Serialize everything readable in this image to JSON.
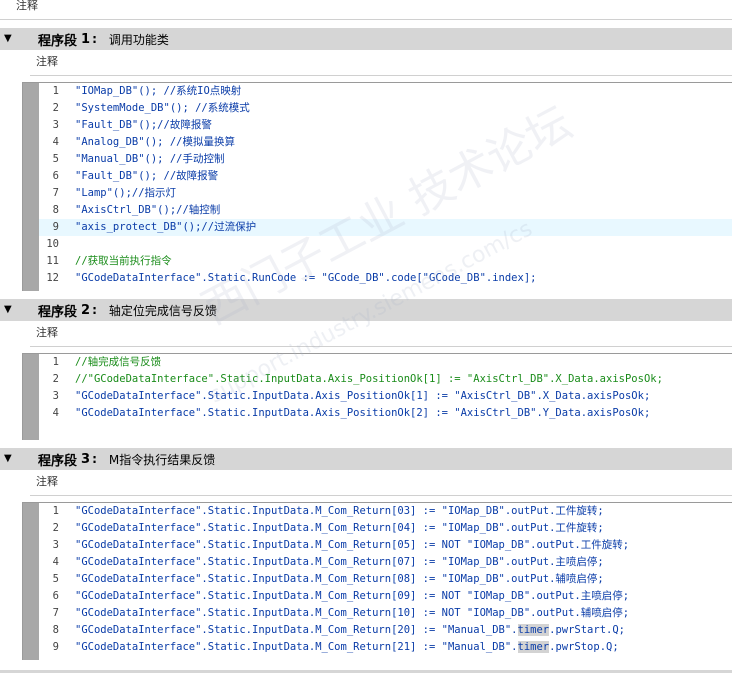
{
  "top": {
    "comment_label": "注释"
  },
  "segments": [
    {
      "label": "程序段",
      "number": "1",
      "title": "调用功能类",
      "comment_label": "注释",
      "lines": [
        {
          "n": "1",
          "code": "\"IOMap_DB\"(); //系统IO点映射"
        },
        {
          "n": "2",
          "code": "\"SystemMode_DB\"(); //系统模式"
        },
        {
          "n": "3",
          "code": "\"Fault_DB\"();//故障报警"
        },
        {
          "n": "4",
          "code": "\"Analog_DB\"(); //模拟量换算"
        },
        {
          "n": "5",
          "code": "\"Manual_DB\"(); //手动控制"
        },
        {
          "n": "6",
          "code": "\"Fault_DB\"(); //故障报警"
        },
        {
          "n": "7",
          "code": "\"Lamp\"();//指示灯"
        },
        {
          "n": "8",
          "code": "\"AxisCtrl_DB\"();//轴控制"
        },
        {
          "n": "9",
          "code": "\"axis_protect_DB\"();//过流保护"
        },
        {
          "n": "10",
          "code": ""
        },
        {
          "n": "11",
          "code": "//获取当前执行指令"
        },
        {
          "n": "12",
          "code": "\"GCodeDataInterface\".Static.RunCode := \"GCode_DB\".code[\"GCode_DB\".index];"
        }
      ]
    },
    {
      "label": "程序段",
      "number": "2",
      "title": "轴定位完成信号反馈",
      "comment_label": "注释",
      "lines": [
        {
          "n": "1",
          "code": "//轴完成信号反馈"
        },
        {
          "n": "2",
          "code": "//\"GCodeDataInterface\".Static.InputData.Axis_PositionOk[1] := \"AxisCtrl_DB\".X_Data.axisPosOk;"
        },
        {
          "n": "3",
          "code": "\"GCodeDataInterface\".Static.InputData.Axis_PositionOk[1] := \"AxisCtrl_DB\".X_Data.axisPosOk;"
        },
        {
          "n": "4",
          "code": "\"GCodeDataInterface\".Static.InputData.Axis_PositionOk[2] := \"AxisCtrl_DB\".Y_Data.axisPosOk;"
        }
      ]
    },
    {
      "label": "程序段",
      "number": "3",
      "title": "M指令执行结果反馈",
      "comment_label": "注释",
      "lines": [
        {
          "n": "1",
          "code": "\"GCodeDataInterface\".Static.InputData.M_Com_Return[03] := \"IOMap_DB\".outPut.工件旋转;"
        },
        {
          "n": "2",
          "code": "\"GCodeDataInterface\".Static.InputData.M_Com_Return[04] := \"IOMap_DB\".outPut.工件旋转;"
        },
        {
          "n": "3",
          "code": "\"GCodeDataInterface\".Static.InputData.M_Com_Return[05] := NOT \"IOMap_DB\".outPut.工件旋转;"
        },
        {
          "n": "4",
          "code": "\"GCodeDataInterface\".Static.InputData.M_Com_Return[07] := \"IOMap_DB\".outPut.主喷启停;"
        },
        {
          "n": "5",
          "code": "\"GCodeDataInterface\".Static.InputData.M_Com_Return[08] := \"IOMap_DB\".outPut.辅喷启停;"
        },
        {
          "n": "6",
          "code": "\"GCodeDataInterface\".Static.InputData.M_Com_Return[09] := NOT \"IOMap_DB\".outPut.主喷启停;"
        },
        {
          "n": "7",
          "code": "\"GCodeDataInterface\".Static.InputData.M_Com_Return[10] := NOT \"IOMap_DB\".outPut.辅喷启停;"
        },
        {
          "n": "8",
          "code_pre": "\"GCodeDataInterface\".Static.InputData.M_Com_Return[20] := \"Manual_DB\".",
          "code_mark": "timer",
          "code_post": ".pwrStart.Q;"
        },
        {
          "n": "9",
          "code_pre": "\"GCodeDataInterface\".Static.InputData.M_Com_Return[21] := \"Manual_DB\".",
          "code_mark": "timer",
          "code_post": ".pwrStop.Q;"
        }
      ]
    }
  ],
  "watermark": {
    "text1": "西门子工业  技术论坛",
    "text2": "support.industry.siemens.com/cs"
  },
  "colors": {
    "header_bg": "#d6d6d6",
    "code_text": "#0a3ca8",
    "comment_text": "#1a8c1a",
    "highlight_line": "#e8f8ff"
  }
}
